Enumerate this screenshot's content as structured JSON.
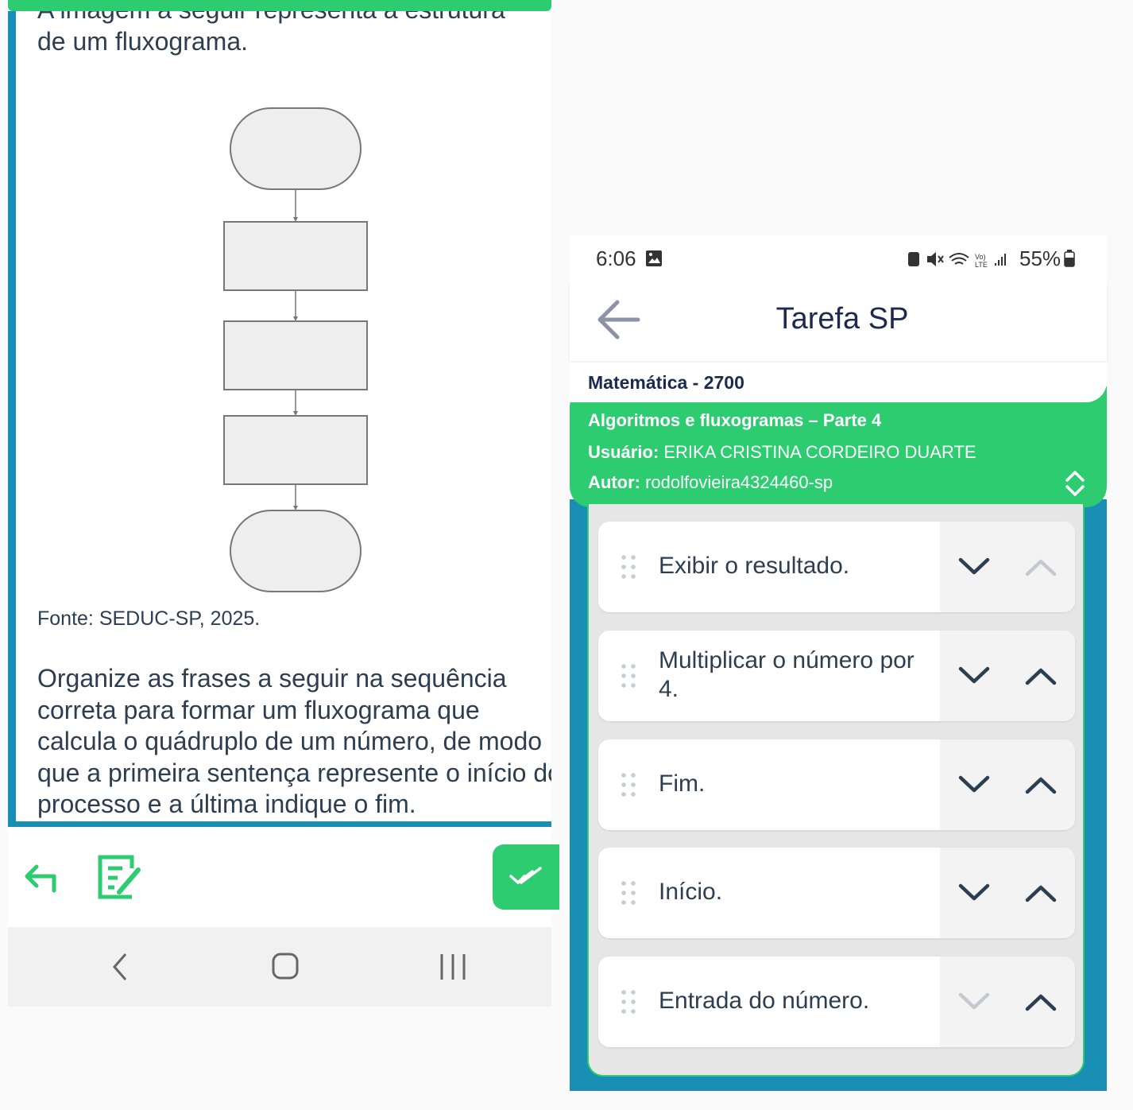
{
  "left": {
    "paragraph_line1": "A imagem a seguir representa a estrutura",
    "paragraph_line2": "de um fluxograma.",
    "fonte": "Fonte: SEDUC-SP, 2025.",
    "question": "Organize as frases a seguir na sequência correta para formar um fluxograma que calcula o quádruplo de um número, de modo que a primeira sentença represente o início do processo e a última indique o fim."
  },
  "right": {
    "status": {
      "time": "6:06",
      "battery": "55%"
    },
    "header": {
      "title": "Tarefa SP"
    },
    "subject": "Matemática - 2700",
    "task_title": "Algoritmos e fluxogramas – Parte 4",
    "user_label": "Usuário:",
    "user_value": " ERIKA CRISTINA CORDEIRO DUARTE",
    "author_label": "Autor:",
    "author_value": " rodolfovieira4324460-sp",
    "items": [
      {
        "text": "Exibir o resultado.",
        "down_enabled": true,
        "up_enabled": false
      },
      {
        "text": "Multiplicar o número por 4.",
        "down_enabled": true,
        "up_enabled": true
      },
      {
        "text": "Fim.",
        "down_enabled": true,
        "up_enabled": true
      },
      {
        "text": "Início.",
        "down_enabled": true,
        "up_enabled": true
      },
      {
        "text": "Entrada do número.",
        "down_enabled": false,
        "up_enabled": true
      }
    ]
  },
  "colors": {
    "green": "#2ecc71",
    "blue": "#1a8fb5",
    "navy": "#1b2a4e"
  }
}
